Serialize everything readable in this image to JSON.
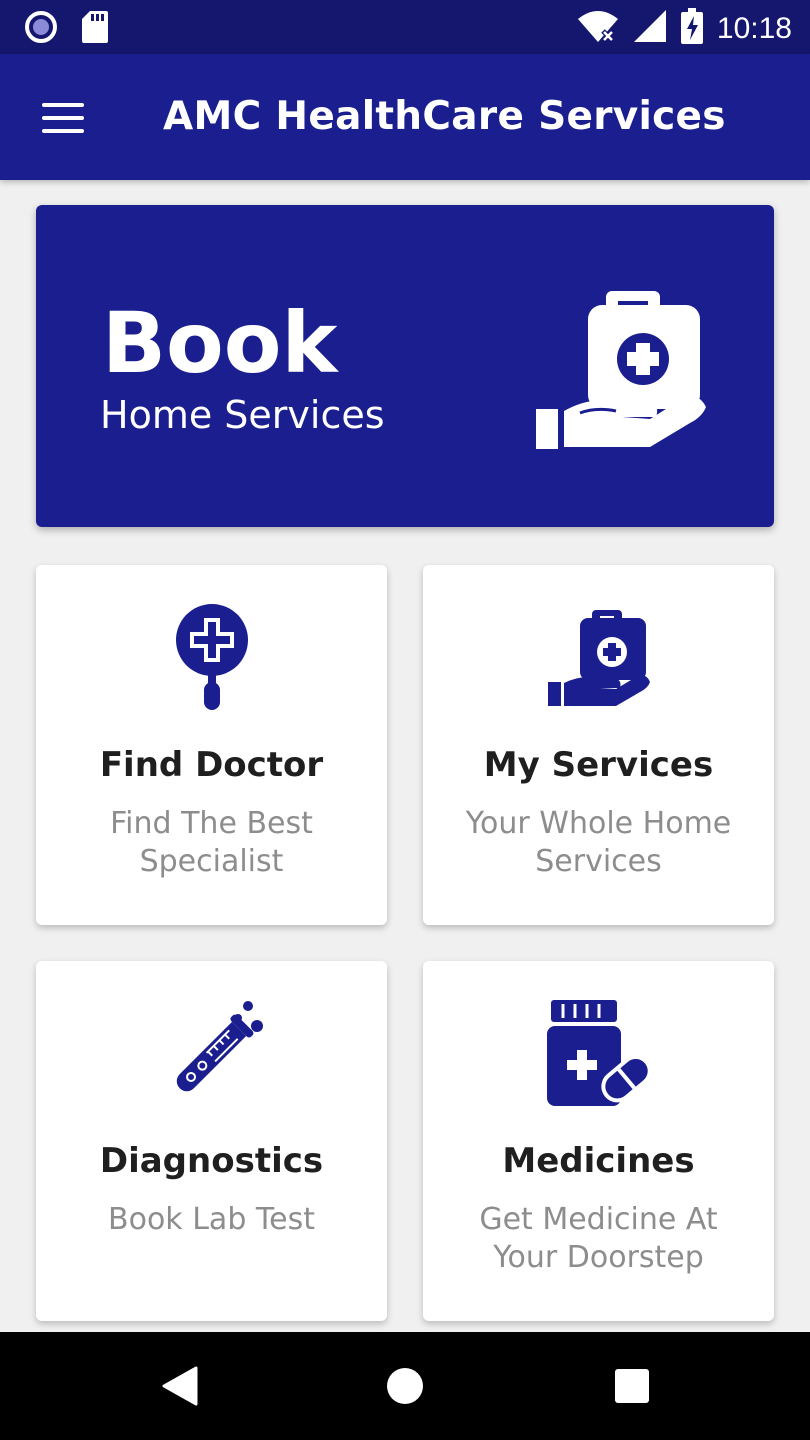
{
  "status_bar": {
    "time": "10:18",
    "icons": [
      "record-icon",
      "sd-card-icon",
      "wifi-off-icon",
      "cell-signal-icon",
      "battery-charging-icon"
    ]
  },
  "app_bar": {
    "title": "AMC HealthCare Services",
    "menu_icon": "hamburger-menu-icon"
  },
  "hero": {
    "title": "Book",
    "subtitle": "Home Services",
    "icon": "medical-kit-hand-icon"
  },
  "cards": [
    {
      "title": "Find Doctor",
      "subtitle": "Find The Best Specialist",
      "icon": "medical-search-icon"
    },
    {
      "title": "My Services",
      "subtitle": "Your Whole Home Services",
      "icon": "medical-kit-hand-icon"
    },
    {
      "title": "Diagnostics",
      "subtitle": "Book Lab Test",
      "icon": "test-tube-icon"
    },
    {
      "title": "Medicines",
      "subtitle": "Get Medicine At Your Doorstep",
      "icon": "medicine-bottle-icon"
    }
  ],
  "nav_bar": {
    "buttons": [
      "back-icon",
      "home-icon",
      "recents-icon"
    ]
  },
  "colors": {
    "primary": "#1a1e8f",
    "status_bar": "#15176e",
    "background": "#f0f0f0",
    "card": "#ffffff",
    "subtitle_text": "#8d8d8d"
  }
}
